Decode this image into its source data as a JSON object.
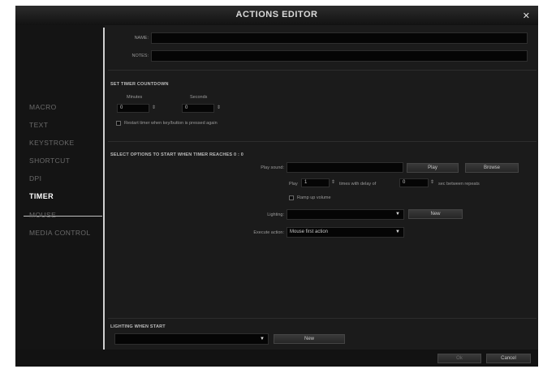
{
  "window": {
    "title": "ACTIONS EDITOR",
    "close_icon": "✕"
  },
  "sidebar": {
    "items": [
      {
        "label": "MACRO"
      },
      {
        "label": "TEXT"
      },
      {
        "label": "KEYSTROKE"
      },
      {
        "label": "SHORTCUT"
      },
      {
        "label": "DPI"
      },
      {
        "label": "TIMER",
        "active": true
      },
      {
        "label": "MOUSE"
      },
      {
        "label": "MEDIA CONTROL"
      }
    ]
  },
  "form": {
    "name_label": "NAME:",
    "notes_label": "NOTES:",
    "name_value": "",
    "notes_value": ""
  },
  "timer": {
    "section_title": "SET TIMER COUNTDOWN",
    "minutes_label": "Minutes",
    "seconds_label": "Seconds",
    "minutes_value": "0",
    "seconds_value": "0",
    "restart_label": "Restart timer when key/button is pressed again"
  },
  "options": {
    "section_title": "SELECT OPTIONS TO START WHEN TIMER REACHES 0 : 0",
    "play_sound_label": "Play sound:",
    "play_button": "Play",
    "browse_button": "Browse",
    "play_label": "Play",
    "play_count": "1",
    "times_label": "times with delay of",
    "delay_value": "0",
    "repeats_label": "sec between repeats",
    "ramp_label": "Ramp up volume",
    "lighting_label": "Lighting:",
    "lighting_value": "",
    "new_button": "New",
    "execute_label": "Execute action:",
    "execute_value": "Mouse first action"
  },
  "lighting_start": {
    "section_title": "LIGHTING WHEN START",
    "value": "",
    "new_button": "New"
  },
  "footer": {
    "ok_button": "Ok",
    "cancel_button": "Cancel"
  },
  "colors": {
    "background": "#181818",
    "field": "#050505",
    "active_nav": "#ffffff"
  }
}
